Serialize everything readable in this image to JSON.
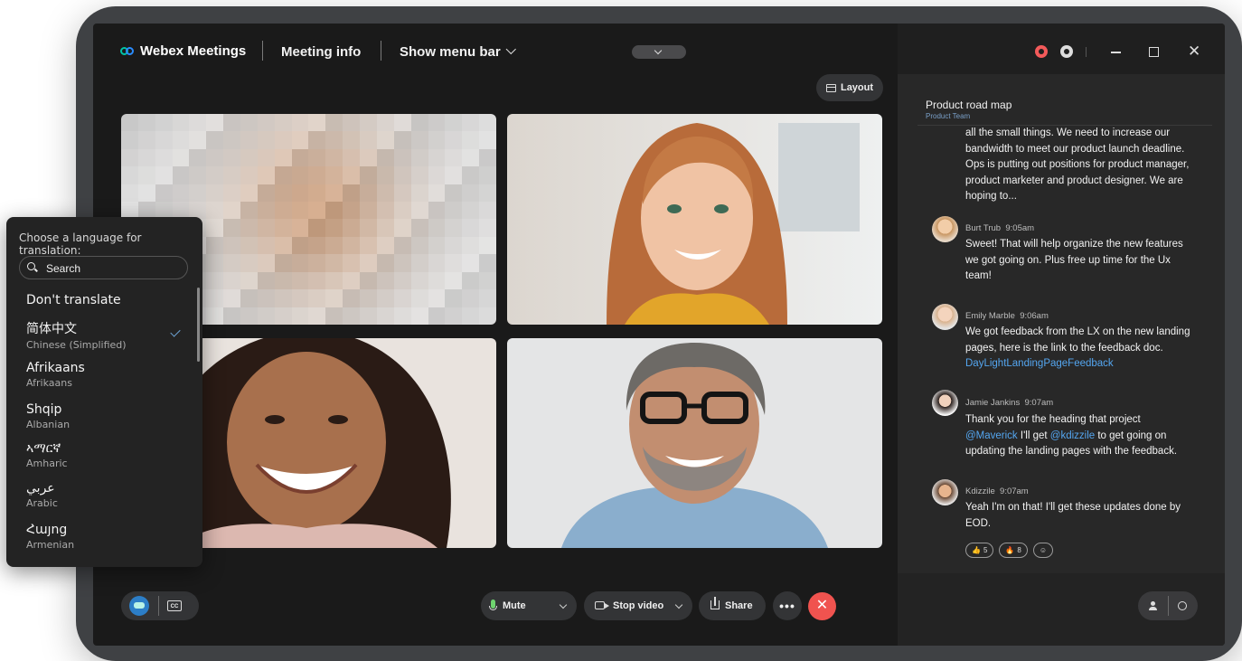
{
  "topbar": {
    "brand": "Webex Meetings",
    "meeting_info": "Meeting info",
    "show_menu_bar": "Show menu bar",
    "layout_label": "Layout"
  },
  "controls": {
    "mute": "Mute",
    "stop_video": "Stop video",
    "share": "Share",
    "more": "•••",
    "end": "✕",
    "cc": "CC"
  },
  "chat": {
    "title": "Product road map",
    "subtitle": "Product Team",
    "messages": [
      {
        "text": "all the small things. We need to increase our bandwidth to meet our product launch deadline. Ops is putting out positions for product manager, product marketer and product designer. We are hoping to..."
      },
      {
        "author": "Burt Trub",
        "time": "9:05am",
        "text": "Sweet! That will help organize the new features we got going on. Plus free up time for the Ux team!"
      },
      {
        "author": "Emily Marble",
        "time": "9:06am",
        "text": "We got feedback from the LX on the new landing pages, here is the link to the feedback doc. ",
        "link": "DayLightLandingPageFeedback"
      },
      {
        "author": "Jamie Jankins",
        "time": "9:07am",
        "text_a": "Thank you for the heading that project ",
        "mention_1": "@Maverick",
        "text_b": " I'll get ",
        "mention_2": "@kdizzile",
        "text_c": " to get going on updating the landing pages with the feedback."
      },
      {
        "author": "Kdizzile",
        "time": "9:07am",
        "text": "Yeah I'm on that! I'll get these updates done by EOD."
      }
    ],
    "reactions": [
      {
        "emoji": "👍",
        "count": "5"
      },
      {
        "emoji": "🔥",
        "count": "8"
      },
      {
        "emoji": "☺",
        "count": ""
      }
    ]
  },
  "translation": {
    "heading": "Choose a language for translation:",
    "search_placeholder": "Search",
    "dont_translate": "Don't translate",
    "languages": [
      {
        "native": "简体中文",
        "english": "Chinese (Simplified)",
        "selected": true
      },
      {
        "native": "Afrikaans",
        "english": "Afrikaans"
      },
      {
        "native": "Shqip",
        "english": "Albanian"
      },
      {
        "native": "ኣማርኛ",
        "english": "Amharic"
      },
      {
        "native": "عربي",
        "english": "Arabic"
      },
      {
        "native": "Հայոց",
        "english": "Armenian"
      }
    ]
  },
  "colors": {
    "accent": "#54a6f0",
    "end_call": "#f0534f",
    "record": "#f35a5a",
    "background": "#1a1a1a"
  }
}
